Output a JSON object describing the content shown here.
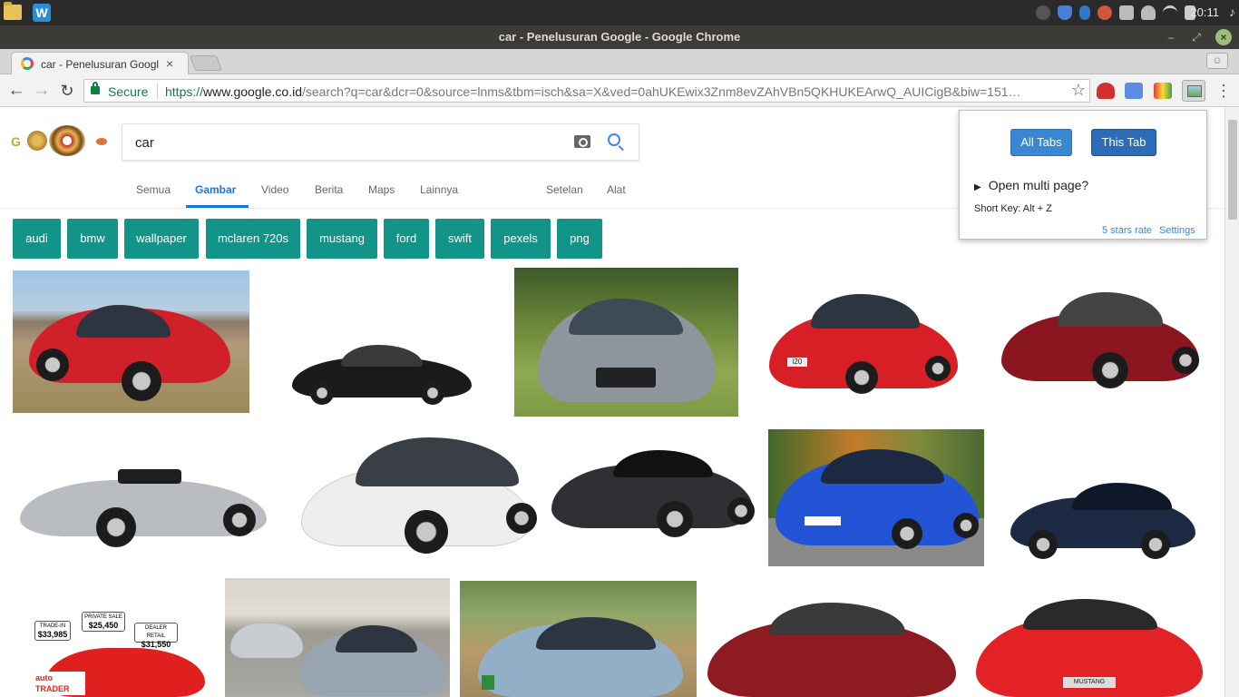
{
  "os": {
    "clock": "20:11",
    "note_glyph": "♪",
    "launcher_w": "W"
  },
  "window": {
    "title": "car - Penelusuran Google - Google Chrome",
    "min_glyph": "‒",
    "max_glyph": "⤢",
    "close_glyph": "×"
  },
  "tab": {
    "title": "car - Penelusuran Google",
    "close_glyph": "×",
    "profile_glyph": "☺"
  },
  "toolbar": {
    "back_glyph": "←",
    "forward_glyph": "→",
    "reload_glyph": "↻",
    "secure_label": "Secure",
    "url_scheme": "https://",
    "url_host": "www.google.co.id",
    "url_rest": "/search?q=car&dcr=0&source=lnms&tbm=isch&sa=X&ved=0ahUKEwix3Znm8evZAhVBn5QKHUKEArwQ_AUICigB&biw=151…",
    "star_glyph": "☆",
    "menu_glyph": "⋮"
  },
  "search": {
    "query": "car",
    "logo_g": "G"
  },
  "nav_tabs": [
    {
      "label": "Semua"
    },
    {
      "label": "Gambar"
    },
    {
      "label": "Video"
    },
    {
      "label": "Berita"
    },
    {
      "label": "Maps"
    },
    {
      "label": "Lainnya"
    },
    {
      "label": "Setelan"
    },
    {
      "label": "Alat"
    }
  ],
  "chips": [
    {
      "label": "audi"
    },
    {
      "label": "bmw"
    },
    {
      "label": "wallpaper"
    },
    {
      "label": "mclaren 720s"
    },
    {
      "label": "mustang"
    },
    {
      "label": "ford"
    },
    {
      "label": "swift"
    },
    {
      "label": "pexels"
    },
    {
      "label": "png"
    }
  ],
  "results": {
    "row1": [
      "red sedan on hillside",
      "black sedan",
      "silver Mercedes-AMG",
      "red Hyundai i20 hatchback",
      "red Buick sedan"
    ],
    "row2": [
      "silver convertible",
      "white Volkswagen hatchback",
      "dark grey Camaro",
      "blue BMW",
      "dark blue SUV"
    ],
    "row3": [
      "red Mazda with price tags",
      "Honda Civic Type R",
      "blue Subaru crossover",
      "red Chevrolet sedan",
      "red Ford Mustang"
    ],
    "price_tags": {
      "trade_in_label": "TRADE-IN",
      "trade_in_value": "$33,985",
      "private_label": "PRIVATE SALE",
      "private_value": "$25,450",
      "dealer_label": "DEALER RETAIL",
      "dealer_value": "$31,550"
    },
    "watermark": "auto TRADER",
    "plate_i20": "i20",
    "plate_mustang": "MUSTANG"
  },
  "popup": {
    "all_tabs": "All Tabs",
    "this_tab": "This Tab",
    "open_multi": "Open multi page?",
    "triangle": "▶",
    "short_key": "Short Key: Alt + Z",
    "rate": "5 stars rate",
    "settings": "Settings"
  }
}
